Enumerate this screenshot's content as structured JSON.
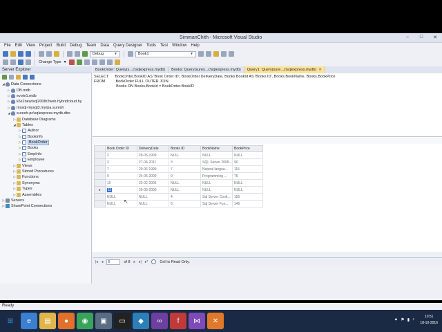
{
  "window": {
    "title": "SimmanChith - Microsoft Visual Studio",
    "controls": [
      "–",
      "□",
      "✕"
    ]
  },
  "menu": [
    "File",
    "Edit",
    "View",
    "Project",
    "Build",
    "Debug",
    "Team",
    "Data",
    "Query Designer",
    "Tools",
    "Test",
    "Window",
    "Help"
  ],
  "toolbar": {
    "config": "Debug",
    "project": "Book1",
    "change_type": "Change Type"
  },
  "explorer": {
    "title": "Server Explorer",
    "nodes": [
      {
        "label": "Data Connections",
        "expander": "◢",
        "icon": "db"
      },
      {
        "label": "DB.mdb",
        "expander": "▷",
        "icon": "db"
      },
      {
        "label": "evote1.mdb",
        "expander": "▷",
        "icon": "db"
      },
      {
        "label": "k6s2new\\sql2008r2web.hybridcloud.hy",
        "expander": "▷",
        "icon": "db"
      },
      {
        "label": "mssql-mysql3.myrpa.suresh",
        "expander": "▷",
        "icon": "db"
      },
      {
        "label": "suresh-pc\\sqlexpress.mydb.dbo",
        "expander": "◢",
        "icon": "db"
      },
      {
        "label": "Database Diagrams",
        "expander": "▷",
        "icon": "fold"
      },
      {
        "label": "Tables",
        "expander": "◢",
        "icon": "fold"
      },
      {
        "label": "Author",
        "expander": "▷",
        "icon": "tbl"
      },
      {
        "label": "BookInfo",
        "expander": "▷",
        "icon": "tbl"
      },
      {
        "label": "BookOrder",
        "expander": "▷",
        "icon": "tbl",
        "selected": true
      },
      {
        "label": "Books",
        "expander": "▷",
        "icon": "tbl"
      },
      {
        "label": "EmpInfo",
        "expander": "▷",
        "icon": "tbl"
      },
      {
        "label": "Employee",
        "expander": "▷",
        "icon": "tbl"
      },
      {
        "label": "Views",
        "expander": "▷",
        "icon": "fold"
      },
      {
        "label": "Stored Procedures",
        "expander": "▷",
        "icon": "fold"
      },
      {
        "label": "Functions",
        "expander": "▷",
        "icon": "fold"
      },
      {
        "label": "Synonyms",
        "expander": "▷",
        "icon": "fold"
      },
      {
        "label": "Types",
        "expander": "▷",
        "icon": "fold"
      },
      {
        "label": "Assemblies",
        "expander": "▷",
        "icon": "fold"
      },
      {
        "label": "Servers",
        "expander": "▷",
        "icon": "srv"
      },
      {
        "label": "SharePoint Connections",
        "expander": "▷",
        "icon": "sp"
      }
    ]
  },
  "tabs": [
    {
      "label": "BookOrder: Query(s...c\\sqlexpress.mydb)",
      "active": false
    },
    {
      "label": "Books: Query(sures...c\\sqlexpress.mydb)",
      "active": false
    },
    {
      "label": "Query1: Query(sure...c\\sqlexpress.mydb)",
      "active": true
    }
  ],
  "sql": [
    "SELECT      BookOrder.BookID AS 'Book Order ID', BookOrder.DeliveryDate, Books.BookId AS 'Books ID', Books.BookName, Books.BookPrice",
    "FROM          BookOrder FULL OUTER JOIN",
    "                     Books ON Books.BookId = BookOrder.BookID"
  ],
  "grid": {
    "columns": [
      "Book Order ID",
      "DeliveryDate",
      "Books ID",
      "BookName",
      "BookPrice"
    ],
    "rows": [
      [
        "2",
        "28-06-1999",
        "NULL",
        "NULL",
        "NULL"
      ],
      [
        "3",
        "27-04-2011",
        "3",
        "SQL Server 2008...",
        "90"
      ],
      [
        "7",
        "20-06-1999",
        "7",
        "Natural langua...",
        "115"
      ],
      [
        "9",
        "24-05-2009",
        "9",
        "Programming ...",
        "75"
      ],
      [
        "10",
        "22-02-2006",
        "NULL",
        "NULL",
        "NULL"
      ],
      [
        "11",
        "26-09-2000",
        "NULL",
        "NULL",
        "NULL"
      ],
      [
        "NULL",
        "NULL",
        "4",
        "Sql Server Cook...",
        "155"
      ],
      [
        "NULL",
        "NULL",
        "6",
        "Sql Server Fun...",
        "145"
      ]
    ],
    "current_row": 5,
    "row_marker": "▸"
  },
  "nav": {
    "first": "|◂",
    "prev": "◂",
    "position": "6",
    "of": "of 8",
    "next": "▸",
    "last": "▸|",
    "new": "▸*",
    "status": "Cell is Read Only."
  },
  "status": {
    "ready": "Ready"
  },
  "taskbar": {
    "time": "10:51",
    "date": "18-10-2016",
    "items": [
      {
        "icon": "windows-icon",
        "color": "#2f8fd8",
        "glyph": "⊞"
      },
      {
        "icon": "ie-icon",
        "color": "#3a7fd0",
        "glyph": "e"
      },
      {
        "icon": "folder-icon",
        "color": "#e0b54a",
        "glyph": "▤"
      },
      {
        "icon": "firefox-icon",
        "color": "#e0702a",
        "glyph": "●"
      },
      {
        "icon": "chrome-icon",
        "color": "#3aa35a",
        "glyph": "◉"
      },
      {
        "icon": "media-icon",
        "color": "#5a6b84",
        "glyph": "▣"
      },
      {
        "icon": "cmd-icon",
        "color": "#222222",
        "glyph": "▭"
      },
      {
        "icon": "app-icon",
        "color": "#2d7fb8",
        "glyph": "◆"
      },
      {
        "icon": "visual-studio-icon",
        "color": "#6c3fa0",
        "glyph": "∞"
      },
      {
        "icon": "flash-icon",
        "color": "#c03a3a",
        "glyph": "f"
      },
      {
        "icon": "vs-icon",
        "color": "#7d4ab8",
        "glyph": "⋈"
      },
      {
        "icon": "xampp-icon",
        "color": "#e07a2a",
        "glyph": "✕"
      }
    ],
    "tray": [
      "▲",
      "⚑",
      "▮",
      "♪"
    ]
  }
}
